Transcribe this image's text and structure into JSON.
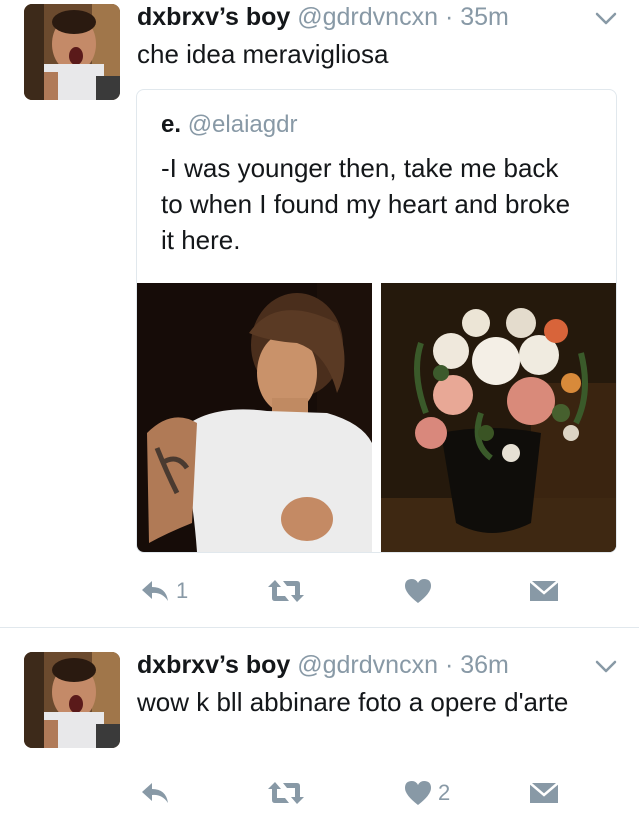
{
  "tweets": [
    {
      "name": "dxbrxv’s boy",
      "handle": "@gdrdvncxn",
      "separator": "·",
      "time": "35m",
      "text": "che idea meravigliosa",
      "quote": {
        "name": "e.",
        "handle": "@elaiagdr",
        "text": "-I was younger then, take me back to when I found my heart and broke it here."
      },
      "actions": {
        "reply_count": "1",
        "retweet_count": "",
        "like_count": ""
      }
    },
    {
      "name": "dxbrxv’s boy",
      "handle": "@gdrdvncxn",
      "separator": "·",
      "time": "36m",
      "text": "wow k bll abbinare foto a opere d'arte",
      "actions": {
        "reply_count": "",
        "retweet_count": "",
        "like_count": "2"
      }
    }
  ],
  "icons": [
    "reply-icon",
    "retweet-icon",
    "like-icon",
    "direct-message-icon",
    "chevron-down-icon"
  ],
  "colors": {
    "text": "#14171a",
    "secondary": "#8899a6",
    "border": "#e1e8ed"
  }
}
